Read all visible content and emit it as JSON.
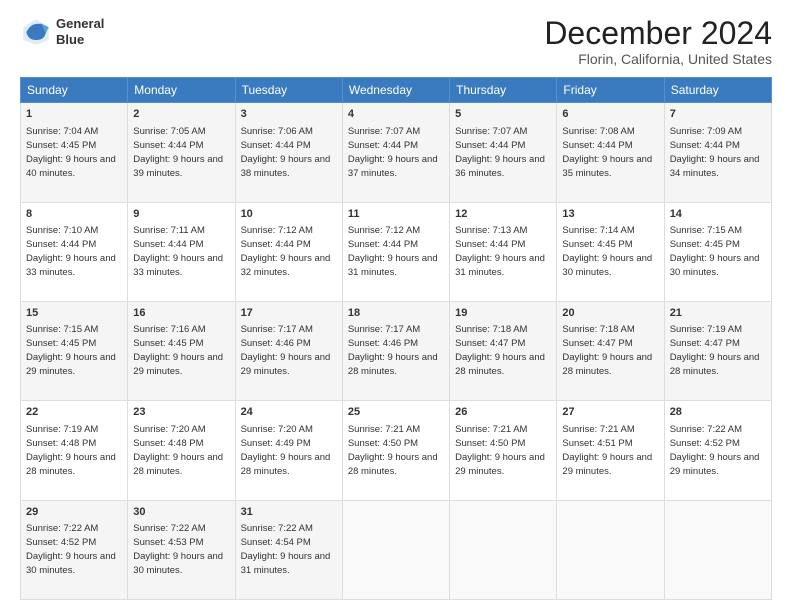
{
  "header": {
    "logo_line1": "General",
    "logo_line2": "Blue",
    "title": "December 2024",
    "subtitle": "Florin, California, United States"
  },
  "calendar": {
    "days_of_week": [
      "Sunday",
      "Monday",
      "Tuesday",
      "Wednesday",
      "Thursday",
      "Friday",
      "Saturday"
    ],
    "weeks": [
      [
        {
          "day": "1",
          "sunrise": "7:04 AM",
          "sunset": "4:45 PM",
          "daylight": "9 hours and 40 minutes."
        },
        {
          "day": "2",
          "sunrise": "7:05 AM",
          "sunset": "4:44 PM",
          "daylight": "9 hours and 39 minutes."
        },
        {
          "day": "3",
          "sunrise": "7:06 AM",
          "sunset": "4:44 PM",
          "daylight": "9 hours and 38 minutes."
        },
        {
          "day": "4",
          "sunrise": "7:07 AM",
          "sunset": "4:44 PM",
          "daylight": "9 hours and 37 minutes."
        },
        {
          "day": "5",
          "sunrise": "7:07 AM",
          "sunset": "4:44 PM",
          "daylight": "9 hours and 36 minutes."
        },
        {
          "day": "6",
          "sunrise": "7:08 AM",
          "sunset": "4:44 PM",
          "daylight": "9 hours and 35 minutes."
        },
        {
          "day": "7",
          "sunrise": "7:09 AM",
          "sunset": "4:44 PM",
          "daylight": "9 hours and 34 minutes."
        }
      ],
      [
        {
          "day": "8",
          "sunrise": "7:10 AM",
          "sunset": "4:44 PM",
          "daylight": "9 hours and 33 minutes."
        },
        {
          "day": "9",
          "sunrise": "7:11 AM",
          "sunset": "4:44 PM",
          "daylight": "9 hours and 33 minutes."
        },
        {
          "day": "10",
          "sunrise": "7:12 AM",
          "sunset": "4:44 PM",
          "daylight": "9 hours and 32 minutes."
        },
        {
          "day": "11",
          "sunrise": "7:12 AM",
          "sunset": "4:44 PM",
          "daylight": "9 hours and 31 minutes."
        },
        {
          "day": "12",
          "sunrise": "7:13 AM",
          "sunset": "4:44 PM",
          "daylight": "9 hours and 31 minutes."
        },
        {
          "day": "13",
          "sunrise": "7:14 AM",
          "sunset": "4:45 PM",
          "daylight": "9 hours and 30 minutes."
        },
        {
          "day": "14",
          "sunrise": "7:15 AM",
          "sunset": "4:45 PM",
          "daylight": "9 hours and 30 minutes."
        }
      ],
      [
        {
          "day": "15",
          "sunrise": "7:15 AM",
          "sunset": "4:45 PM",
          "daylight": "9 hours and 29 minutes."
        },
        {
          "day": "16",
          "sunrise": "7:16 AM",
          "sunset": "4:45 PM",
          "daylight": "9 hours and 29 minutes."
        },
        {
          "day": "17",
          "sunrise": "7:17 AM",
          "sunset": "4:46 PM",
          "daylight": "9 hours and 29 minutes."
        },
        {
          "day": "18",
          "sunrise": "7:17 AM",
          "sunset": "4:46 PM",
          "daylight": "9 hours and 28 minutes."
        },
        {
          "day": "19",
          "sunrise": "7:18 AM",
          "sunset": "4:47 PM",
          "daylight": "9 hours and 28 minutes."
        },
        {
          "day": "20",
          "sunrise": "7:18 AM",
          "sunset": "4:47 PM",
          "daylight": "9 hours and 28 minutes."
        },
        {
          "day": "21",
          "sunrise": "7:19 AM",
          "sunset": "4:47 PM",
          "daylight": "9 hours and 28 minutes."
        }
      ],
      [
        {
          "day": "22",
          "sunrise": "7:19 AM",
          "sunset": "4:48 PM",
          "daylight": "9 hours and 28 minutes."
        },
        {
          "day": "23",
          "sunrise": "7:20 AM",
          "sunset": "4:48 PM",
          "daylight": "9 hours and 28 minutes."
        },
        {
          "day": "24",
          "sunrise": "7:20 AM",
          "sunset": "4:49 PM",
          "daylight": "9 hours and 28 minutes."
        },
        {
          "day": "25",
          "sunrise": "7:21 AM",
          "sunset": "4:50 PM",
          "daylight": "9 hours and 28 minutes."
        },
        {
          "day": "26",
          "sunrise": "7:21 AM",
          "sunset": "4:50 PM",
          "daylight": "9 hours and 29 minutes."
        },
        {
          "day": "27",
          "sunrise": "7:21 AM",
          "sunset": "4:51 PM",
          "daylight": "9 hours and 29 minutes."
        },
        {
          "day": "28",
          "sunrise": "7:22 AM",
          "sunset": "4:52 PM",
          "daylight": "9 hours and 29 minutes."
        }
      ],
      [
        {
          "day": "29",
          "sunrise": "7:22 AM",
          "sunset": "4:52 PM",
          "daylight": "9 hours and 30 minutes."
        },
        {
          "day": "30",
          "sunrise": "7:22 AM",
          "sunset": "4:53 PM",
          "daylight": "9 hours and 30 minutes."
        },
        {
          "day": "31",
          "sunrise": "7:22 AM",
          "sunset": "4:54 PM",
          "daylight": "9 hours and 31 minutes."
        },
        null,
        null,
        null,
        null
      ]
    ]
  }
}
